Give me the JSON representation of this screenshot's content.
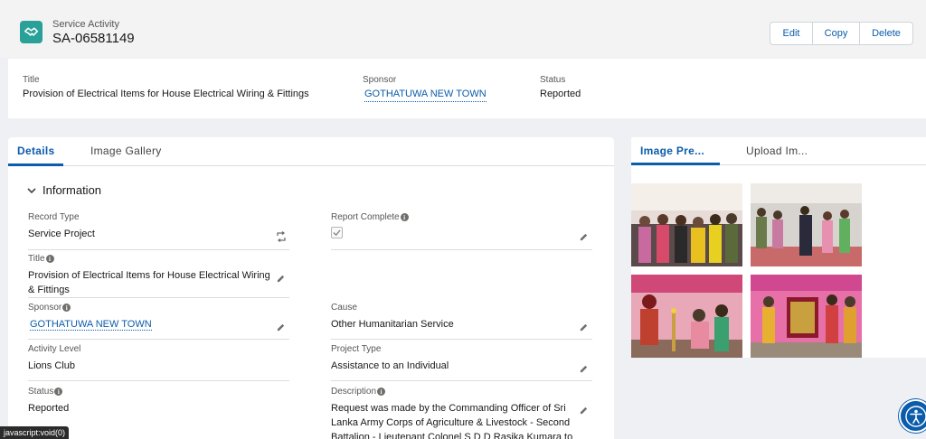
{
  "header": {
    "object_type": "Service Activity",
    "record_name": "SA-06581149",
    "icon": "handshake-icon",
    "accent_color": "#2aa198",
    "actions": {
      "edit": "Edit",
      "copy": "Copy",
      "delete": "Delete"
    }
  },
  "highlights": {
    "title_label": "Title",
    "title_value": "Provision of Electrical Items for House Electrical Wiring & Fittings",
    "sponsor_label": "Sponsor",
    "sponsor_value": "GOTHATUWA NEW TOWN",
    "status_label": "Status",
    "status_value": "Reported"
  },
  "left_tabs": {
    "details": "Details",
    "gallery": "Image Gallery"
  },
  "section": {
    "title": "Information"
  },
  "fields": {
    "record_type_label": "Record Type",
    "record_type_value": "Service Project",
    "report_complete_label": "Report Complete",
    "report_complete_checked": true,
    "title_label": "Title",
    "title_value": "Provision of Electrical Items for House Electrical Wiring & Fittings",
    "sponsor_label": "Sponsor",
    "sponsor_value": "GOTHATUWA NEW TOWN",
    "cause_label": "Cause",
    "cause_value": "Other Humanitarian Service",
    "activity_level_label": "Activity Level",
    "activity_level_value": "Lions Club",
    "project_type_label": "Project Type",
    "project_type_value": "Assistance to an Individual",
    "status_label": "Status",
    "status_value": "Reported",
    "description_label": "Description",
    "description_value": "Request was made by the Commanding Officer of Sri Lanka Army Corps of Agriculture & Livestock - Second Battalion - Lieutenant Colonel S D D Rasika Kumara to"
  },
  "right_tabs": {
    "preview": "Image Pre...",
    "upload": "Upload Im..."
  },
  "gallery_images": [
    {
      "name": "event-photo-1"
    },
    {
      "name": "event-photo-2"
    },
    {
      "name": "event-photo-3"
    },
    {
      "name": "event-photo-4"
    }
  ],
  "statusbar": {
    "text": "javascript:void(0)"
  },
  "accessibility": {
    "icon": "accessibility-icon"
  }
}
